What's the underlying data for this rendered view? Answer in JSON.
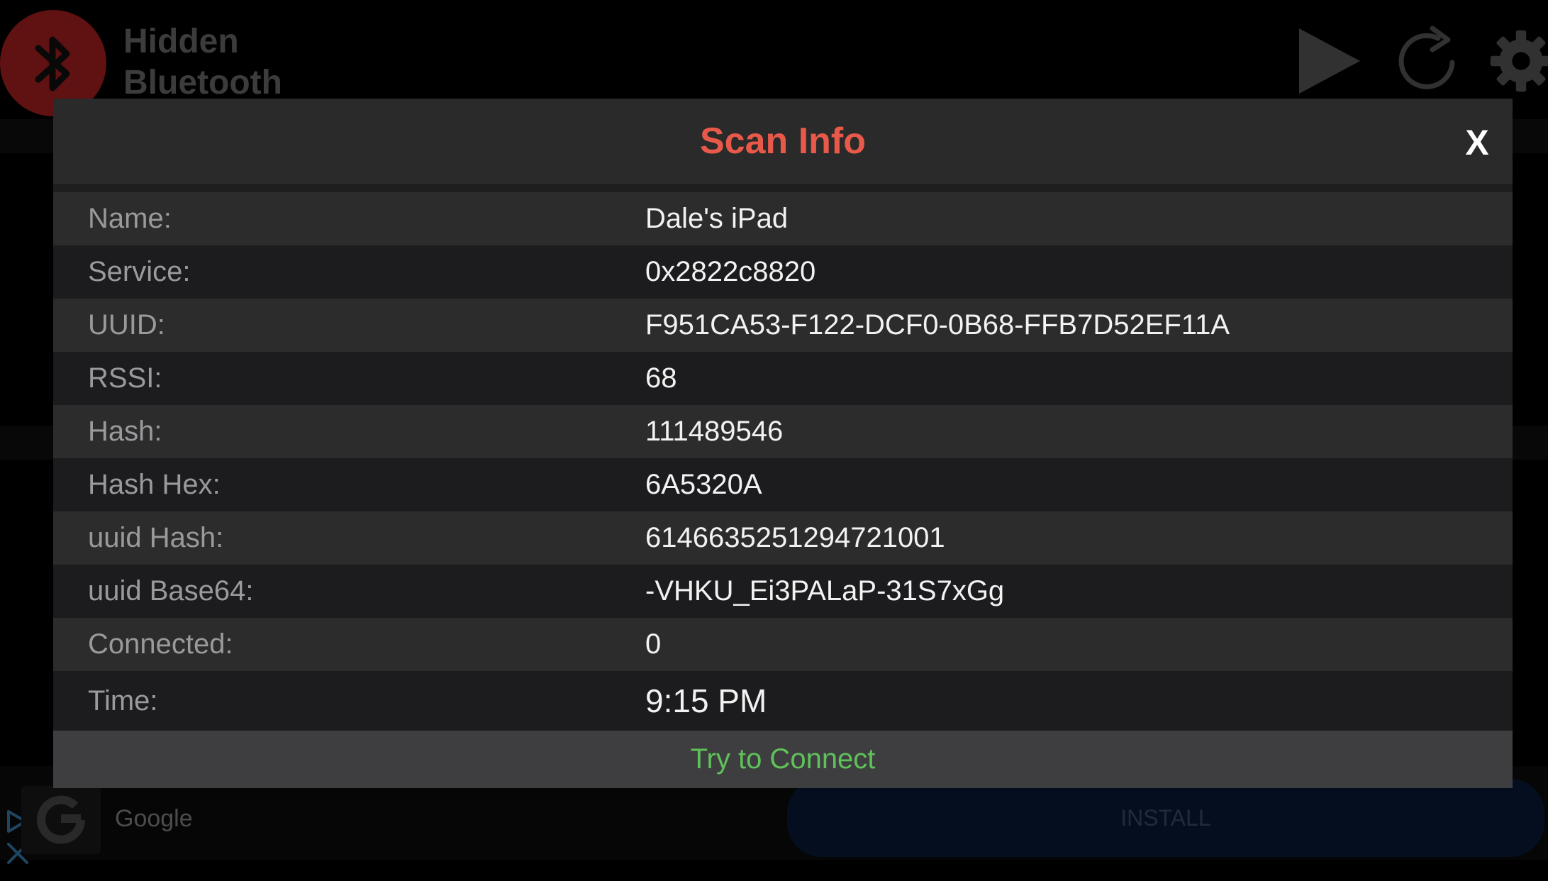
{
  "app": {
    "title_line1": "Hidden",
    "title_line2": "Bluetooth",
    "icons": [
      "bluetooth-icon",
      "play-icon",
      "refresh-icon",
      "gear-icon"
    ]
  },
  "modal": {
    "title": "Scan Info",
    "close_label": "X",
    "rows": [
      {
        "label": "Name:",
        "value": "Dale's iPad"
      },
      {
        "label": "Service:",
        "value": "0x2822c8820"
      },
      {
        "label": "UUID:",
        "value": "F951CA53-F122-DCF0-0B68-FFB7D52EF11A"
      },
      {
        "label": "RSSI:",
        "value": "68"
      },
      {
        "label": "Hash:",
        "value": "111489546"
      },
      {
        "label": "Hash Hex:",
        "value": "6A5320A"
      },
      {
        "label": "uuid Hash:",
        "value": "6146635251294721001"
      },
      {
        "label": "uuid Base64:",
        "value": "-VHKU_Ei3PALaP-31S7xGg"
      },
      {
        "label": "Connected:",
        "value": "0"
      },
      {
        "label": "Time:",
        "value": "9:15 PM"
      }
    ],
    "connect_label": "Try to Connect"
  },
  "ad": {
    "advertiser": "Google",
    "cta": "INSTALL"
  },
  "colors": {
    "title": "#e8594a",
    "connect": "#5fc15a",
    "logo": "#b0201f"
  }
}
